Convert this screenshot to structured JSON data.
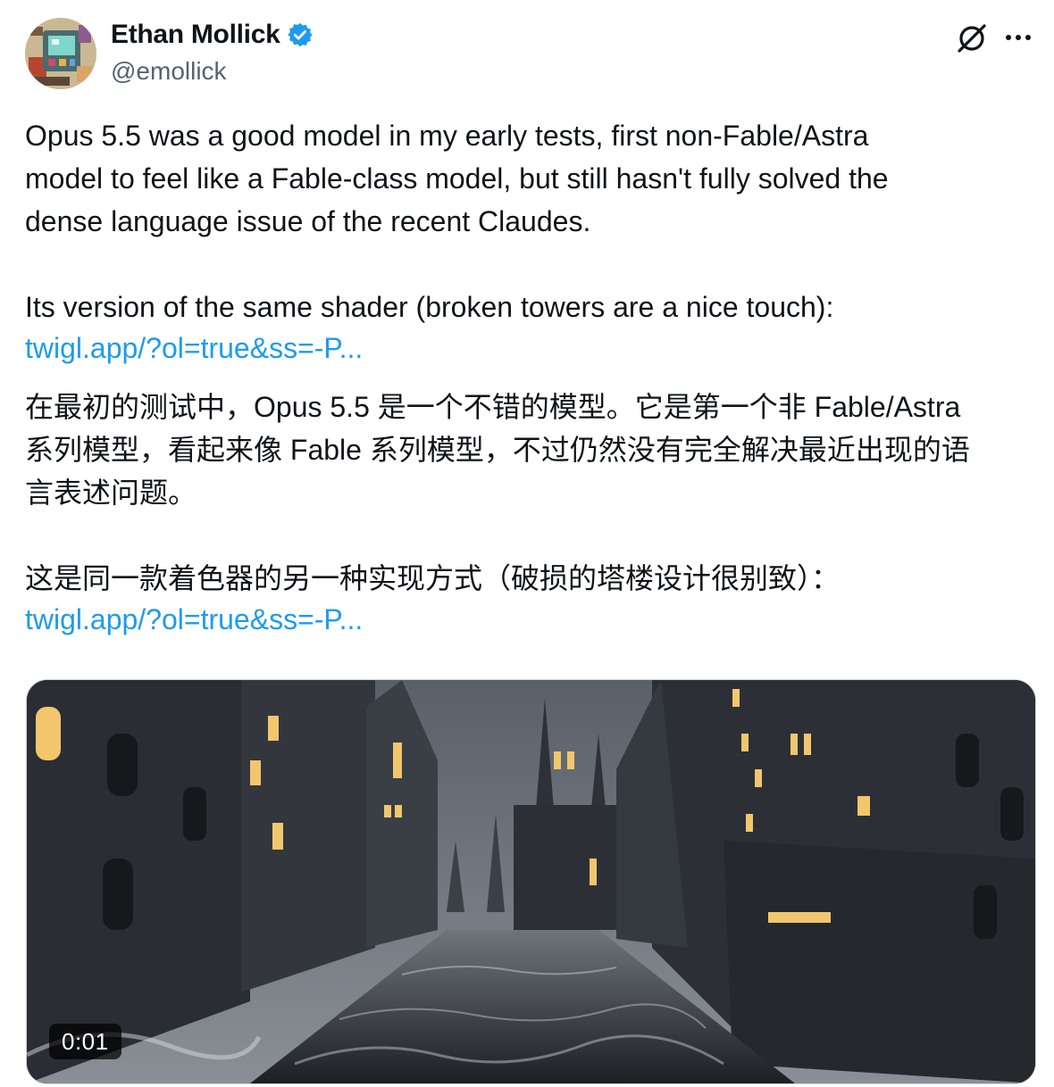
{
  "author": {
    "display_name": "Ethan Mollick",
    "handle": "@emollick",
    "verified": true,
    "avatar_icon": "pixel-art-avatar",
    "verified_icon": "verified-badge-icon"
  },
  "actions": {
    "grok_icon": "grok-icon",
    "more_icon": "more-icon"
  },
  "tweet": {
    "para1": "Opus 5.5 was a good model in my early tests, first non-Fable/Astra\nmodel to feel like a Fable-class model, but still hasn't fully solved the\ndense language issue of the recent Claudes.",
    "para2": "Its version of the same shader (broken towers are a nice touch):",
    "link1": "twigl.app/?ol=true&ss=-P...",
    "translation_para1": "在最初的测试中，Opus 5.5 是一个不错的模型。它是第一个非 Fable/Astra\n系列模型，看起来像 Fable 系列模型，不过仍然没有完全解决最近出现的语\n言表述问题。",
    "translation_para2": "这是同一款着色器的另一种实现方式（破损的塔楼设计很别致）：",
    "link2": "twigl.app/?ol=true&ss=-P..."
  },
  "media": {
    "type": "video",
    "duration": "0:01"
  },
  "colors": {
    "link": "#1d9bf0",
    "verified": "#1d9bf0",
    "secondary_text": "#536471"
  }
}
